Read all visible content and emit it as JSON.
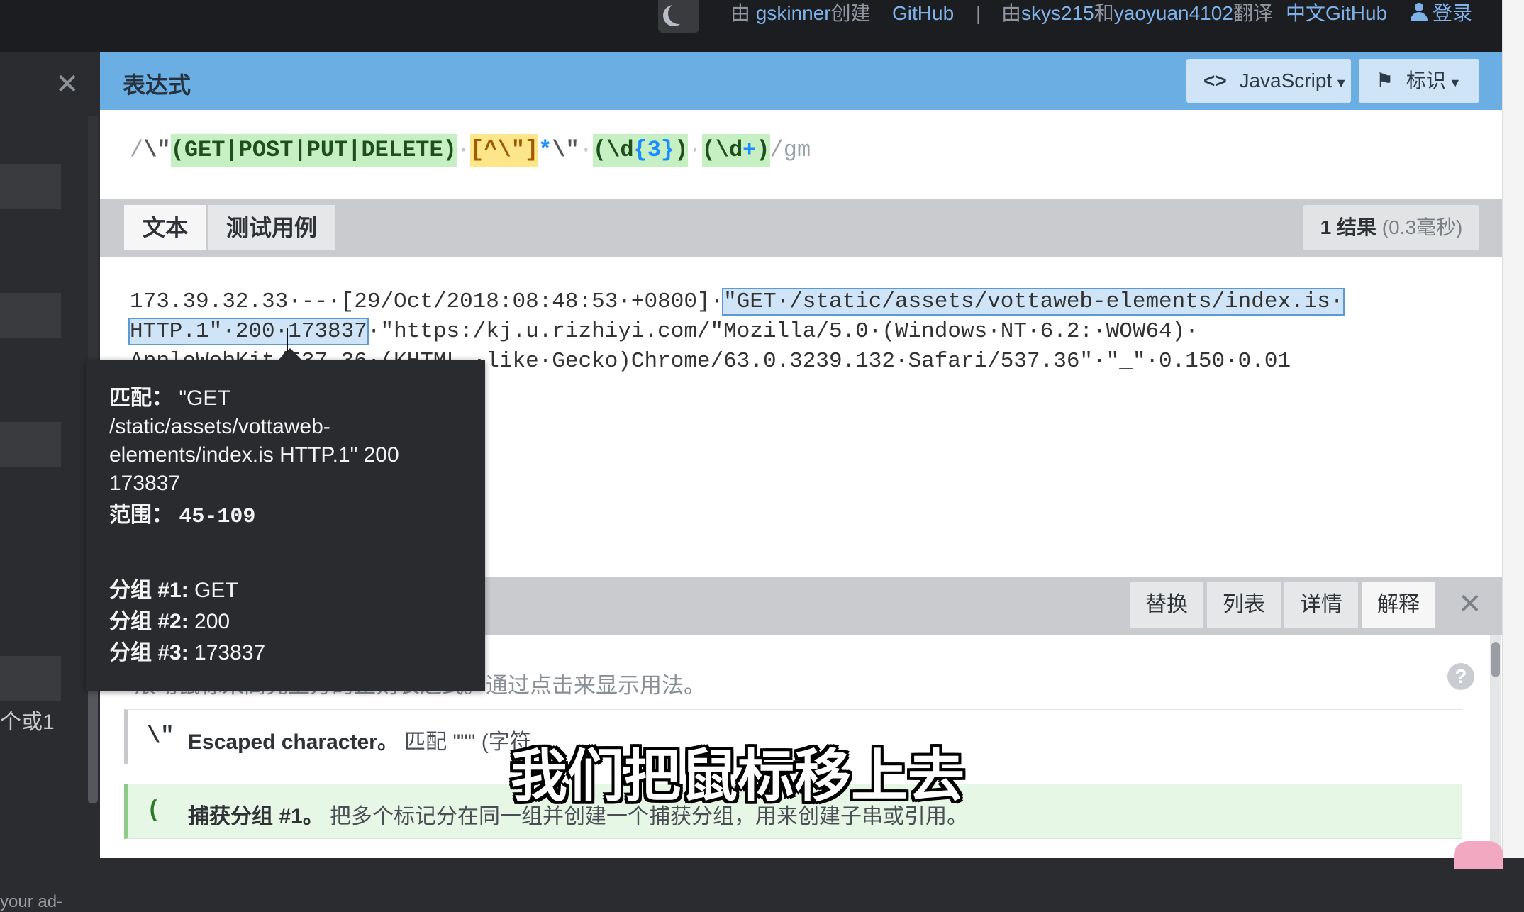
{
  "topbar": {
    "links": [
      {
        "prefix": "由 ",
        "name": "gskinner",
        "suffix": "创建"
      },
      {
        "name": "GitHub"
      },
      {
        "sep": "|"
      },
      {
        "prefix": "由",
        "name": "skys215",
        "mid": "和",
        "name2": "yaoyuan4102",
        "suffix": "翻译"
      },
      {
        "name": "中文GitHub"
      },
      {
        "name": "登录"
      }
    ],
    "icons": [
      "moon-icon",
      "user-icon"
    ]
  },
  "sidebar": {
    "text_fragment": "个或1",
    "text_fragment_bottom": "your ad-"
  },
  "expression": {
    "title": "表达式",
    "flavor_label": "JavaScript",
    "flags_label": "标识",
    "tokens": {
      "open_slash": "/",
      "escape_quote_1": "\\\"",
      "group1": "(GET|POST|PUT|DELETE)",
      "space1": "·",
      "char_class": "[^\\\"]",
      "star": "*",
      "escape_quote_2": "\\\"",
      "space2": "·",
      "group2_open": "(\\d",
      "group2_quant": "{3}",
      "group2_close": ")",
      "space3": "·",
      "group3_open": "(\\d",
      "group3_quant": "+",
      "group3_close": ")",
      "flags": "/gm"
    }
  },
  "text_panel": {
    "tabs": [
      "文本",
      "测试用例"
    ],
    "result_count": "1 结果",
    "result_time": "(0.3毫秒)",
    "line1_pre": "173.39.32.33·--·[29/Oct/2018:08:48:53·+0800]·",
    "line1_match": "\"GET·/static/assets/vottaweb-elements/index.is·",
    "line2_match": "HTTP.1\"·200·173837",
    "line2_post": "·\"https:/kj.u.rizhiyi.com/\"Mozilla/5.0·(Windows·NT·6.2:·WOW64)·",
    "line3": "AppleWebKit/537.36·(KHTML,·like·Gecko)Chrome/63.0.3239.132·Safari/537.36\"·\"_\"·0.150·0.01"
  },
  "tooltip": {
    "match_label": "匹配：",
    "match_lines": [
      "\"GET",
      "/static/assets/vottaweb-",
      "elements/index.is HTTP.1\" 200",
      "173837"
    ],
    "range_label": "范围：",
    "range_value": "45-109",
    "groups": [
      {
        "label": "分组 #1:",
        "value": "GET"
      },
      {
        "label": "分组 #2:",
        "value": "200"
      },
      {
        "label": "分组 #3:",
        "value": "173837"
      }
    ]
  },
  "tools": {
    "buttons": [
      "替换",
      "列表",
      "详情",
      "解释"
    ],
    "hint": "滚动鼠标来高亮上方的正则表达式。通过点击来显示用法。",
    "help": "?",
    "cards": [
      {
        "token": "\\\"",
        "title": "Escaped character。",
        "desc": "匹配 \"\"\" (字符"
      },
      {
        "token": "(",
        "title": "捕获分组 #1。",
        "desc": "把多个标记分在同一组并创建一个捕获分组，用来创建子串或引用。"
      }
    ]
  },
  "subtitle": "我们把鼠标移上去",
  "colors": {
    "header_blue": "#6aaee3",
    "group_green": "#c6f0c4",
    "class_yellow": "#fde68a",
    "match_blue": "#cfe4f7",
    "tooltip_bg": "#2a2b2e"
  }
}
